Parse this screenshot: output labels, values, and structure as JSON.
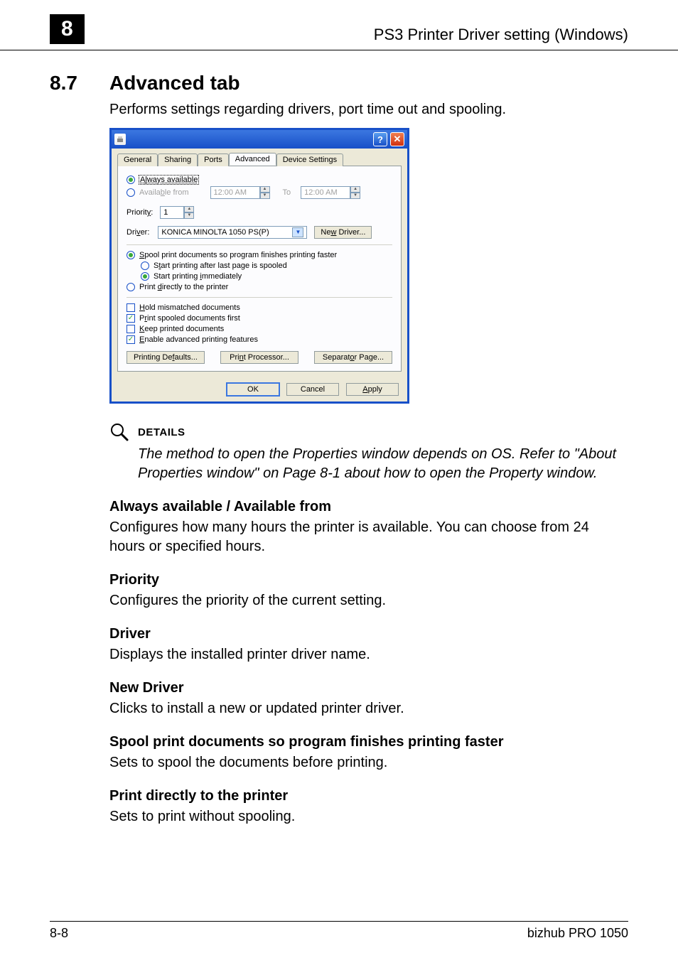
{
  "header": {
    "chapter": "8",
    "title": "PS3 Printer Driver setting (Windows)"
  },
  "section": {
    "number": "8.7",
    "title": "Advanced tab",
    "intro": "Performs settings regarding drivers, port time out and spooling."
  },
  "dialog": {
    "tabs": {
      "general": "General",
      "sharing": "Sharing",
      "ports": "Ports",
      "advanced": "Advanced",
      "device": "Device Settings"
    },
    "always_available_pre": "A",
    "always_available_mid": "l",
    "always_available_post": "ways available",
    "available_from": "Available from",
    "availb": "b",
    "time1": "12:00 AM",
    "to": "To",
    "time2": "12:00 AM",
    "priority_label": "Priority:",
    "priority_y": "y",
    "priority_val": "1",
    "driver_label": "Driver:",
    "driver_v": "v",
    "driver_name": "KONICA MINOLTA 1050 PS(P)",
    "new_driver": "New Driver...",
    "new_w": "w",
    "spool_main": "Spool print documents so program finishes printing faster",
    "spool_s": "S",
    "spool_sub1": "Start printing after last page is spooled",
    "spool_t": "t",
    "spool_sub2": "Start printing immediately",
    "spool_i": "i",
    "print_direct": "Print directly to the printer",
    "print_d": "d",
    "hold": "Hold mismatched documents",
    "hold_h": "H",
    "spooled_first": "Print spooled documents first",
    "spooled_r": "r",
    "keep": "Keep printed documents",
    "keep_k": "K",
    "enable": "Enable advanced printing features",
    "enable_e": "E",
    "printing_defaults": "Printing Defaults...",
    "pf_f": "f",
    "print_processor": "Print Processor...",
    "pp_n": "n",
    "separator": "Separator Page...",
    "sep_o": "o",
    "ok": "OK",
    "cancel": "Cancel",
    "apply": "Apply",
    "apply_a": "A"
  },
  "details": {
    "label": "DETAILS",
    "text": "The method to open the Properties window depends on OS. Refer to \"About Properties window\" on Page 8-1 about how to open the Property window."
  },
  "items": {
    "h1": "Always available / Available from",
    "t1": "Configures how many hours the printer is available. You can choose from 24 hours or specified hours.",
    "h2": "Priority",
    "t2": "Configures the priority of the current setting.",
    "h3": "Driver",
    "t3": "Displays the installed printer driver name.",
    "h4": "New Driver",
    "t4": "Clicks to install a new or updated printer driver.",
    "h5": "Spool print documents so program finishes printing faster",
    "t5": "Sets to spool the documents before printing.",
    "h6": "Print directly to the printer",
    "t6": "Sets to print without spooling."
  },
  "footer": {
    "page": "8-8",
    "product": "bizhub PRO 1050"
  }
}
